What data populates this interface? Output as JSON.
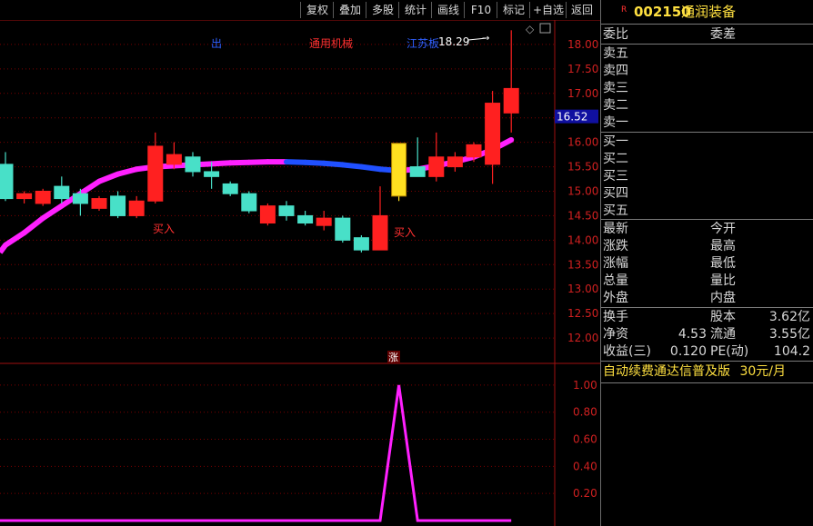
{
  "toolbar": {
    "buttons": [
      "复权",
      "叠加",
      "多股",
      "统计",
      "画线",
      "F10",
      "标记",
      "+自选",
      "返回"
    ]
  },
  "stock": {
    "flag": "R",
    "code": "002150",
    "name": "通润装备"
  },
  "order_book": {
    "header_left": "委比",
    "header_right": "委差",
    "sell": [
      "卖五",
      "卖四",
      "卖三",
      "卖二",
      "卖一"
    ],
    "buy": [
      "买一",
      "买二",
      "买三",
      "买四",
      "买五"
    ]
  },
  "quote": {
    "rows": [
      {
        "left": "最新",
        "right": "今开"
      },
      {
        "left": "涨跌",
        "right": "最高"
      },
      {
        "left": "涨幅",
        "right": "最低"
      },
      {
        "left": "总量",
        "right": "量比"
      },
      {
        "left": "外盘",
        "right": "内盘"
      }
    ]
  },
  "fundamentals": {
    "rows": [
      {
        "l1": "换手",
        "v1": "",
        "l2": "股本",
        "v2": "3.62亿"
      },
      {
        "l1": "净资",
        "v1": "4.53",
        "l2": "流通",
        "v2": "3.55亿"
      },
      {
        "l1": "收益(三)",
        "v1": "0.120",
        "l2": "PE(动)",
        "v2": "104.2"
      }
    ]
  },
  "ad": {
    "text": "自动续费通达信普及版",
    "price": "30元/月"
  },
  "colors": {
    "up": "#ff2020",
    "down": "#48e0c8",
    "ma_up": "#ff20ff",
    "ma_down": "#2050ff",
    "limit_up": "#ffe020",
    "grid": "#7a0000",
    "axis_text": "#d02020",
    "indicator": "#ff20ff"
  },
  "chart_data": {
    "type": "candlestick",
    "y_axis": {
      "ticks": [
        12.0,
        12.5,
        13.0,
        13.5,
        14.0,
        14.5,
        15.0,
        15.5,
        16.0,
        16.5,
        17.0,
        17.5,
        18.0
      ],
      "ylim": [
        11.5,
        18.5
      ]
    },
    "current_price_label": "16.52",
    "candles": [
      {
        "o": 14.85,
        "c": 15.55,
        "h": 15.8,
        "l": 14.8,
        "dir": "down"
      },
      {
        "o": 14.85,
        "c": 14.95,
        "h": 15.0,
        "l": 14.75,
        "dir": "up"
      },
      {
        "o": 14.75,
        "c": 15.0,
        "h": 15.05,
        "l": 14.7,
        "dir": "up"
      },
      {
        "o": 15.1,
        "c": 14.85,
        "h": 15.3,
        "l": 14.75,
        "dir": "down"
      },
      {
        "o": 14.95,
        "c": 14.75,
        "h": 15.05,
        "l": 14.5,
        "dir": "down"
      },
      {
        "o": 14.65,
        "c": 14.85,
        "h": 14.9,
        "l": 14.6,
        "dir": "up"
      },
      {
        "o": 14.9,
        "c": 14.5,
        "h": 15.0,
        "l": 14.45,
        "dir": "down"
      },
      {
        "o": 14.5,
        "c": 14.8,
        "h": 14.9,
        "l": 14.45,
        "dir": "up"
      },
      {
        "o": 14.8,
        "c": 15.92,
        "h": 16.2,
        "l": 14.75,
        "dir": "up",
        "buy_signal": true
      },
      {
        "o": 15.55,
        "c": 15.75,
        "h": 16.0,
        "l": 15.45,
        "dir": "up"
      },
      {
        "o": 15.7,
        "c": 15.4,
        "h": 15.8,
        "l": 15.3,
        "dir": "down"
      },
      {
        "o": 15.4,
        "c": 15.3,
        "h": 15.6,
        "l": 15.05,
        "dir": "down"
      },
      {
        "o": 15.15,
        "c": 14.95,
        "h": 15.2,
        "l": 14.9,
        "dir": "down"
      },
      {
        "o": 14.95,
        "c": 14.6,
        "h": 15.0,
        "l": 14.55,
        "dir": "down"
      },
      {
        "o": 14.35,
        "c": 14.7,
        "h": 14.75,
        "l": 14.3,
        "dir": "up"
      },
      {
        "o": 14.7,
        "c": 14.5,
        "h": 14.8,
        "l": 14.4,
        "dir": "down"
      },
      {
        "o": 14.5,
        "c": 14.35,
        "h": 14.6,
        "l": 14.3,
        "dir": "down"
      },
      {
        "o": 14.3,
        "c": 14.45,
        "h": 14.6,
        "l": 14.2,
        "dir": "up"
      },
      {
        "o": 14.45,
        "c": 14.0,
        "h": 14.5,
        "l": 13.95,
        "dir": "down"
      },
      {
        "o": 14.05,
        "c": 13.8,
        "h": 14.1,
        "l": 13.75,
        "dir": "down"
      },
      {
        "o": 13.8,
        "c": 14.5,
        "h": 15.1,
        "l": 13.8,
        "dir": "up",
        "buy_signal": true
      },
      {
        "o": 14.9,
        "c": 15.98,
        "h": 15.98,
        "l": 14.8,
        "dir": "limit_up"
      },
      {
        "o": 15.3,
        "c": 15.5,
        "h": 16.1,
        "l": 15.3,
        "dir": "down"
      },
      {
        "o": 15.3,
        "c": 15.7,
        "h": 16.2,
        "l": 15.2,
        "dir": "up"
      },
      {
        "o": 15.5,
        "c": 15.7,
        "h": 15.8,
        "l": 15.4,
        "dir": "up"
      },
      {
        "o": 15.7,
        "c": 15.95,
        "h": 16.0,
        "l": 15.6,
        "dir": "up"
      },
      {
        "o": 15.55,
        "c": 16.8,
        "h": 17.05,
        "l": 15.15,
        "dir": "up"
      },
      {
        "o": 16.6,
        "c": 17.1,
        "h": 18.29,
        "l": 16.2,
        "dir": "up"
      }
    ],
    "ma": [
      13.9,
      14.15,
      14.45,
      14.7,
      14.95,
      15.2,
      15.35,
      15.45,
      15.5,
      15.52,
      15.54,
      15.56,
      15.58,
      15.59,
      15.6,
      15.6,
      15.59,
      15.57,
      15.54,
      15.5,
      15.45,
      15.42,
      15.45,
      15.52,
      15.6,
      15.7,
      15.85,
      16.05
    ],
    "annotations": [
      {
        "text": "出",
        "color": "blue"
      },
      {
        "text": "通用机械",
        "color": "red"
      },
      {
        "text": "江苏板",
        "color": "blue"
      },
      {
        "text": "18.29",
        "color": "white"
      },
      {
        "text": "买入",
        "color": "red"
      },
      {
        "text": "买入",
        "color": "red"
      }
    ],
    "limit_tag": "涨",
    "indicator": {
      "ticks": [
        0.2,
        0.4,
        0.6,
        0.8,
        1.0
      ],
      "ylim": [
        0,
        1.1
      ],
      "values": [
        0,
        0,
        0,
        0,
        0,
        0,
        0,
        0,
        0,
        0,
        0,
        0,
        0,
        0,
        0,
        0,
        0,
        0,
        0,
        0,
        0,
        1,
        0,
        0,
        0,
        0,
        0,
        0
      ]
    }
  }
}
